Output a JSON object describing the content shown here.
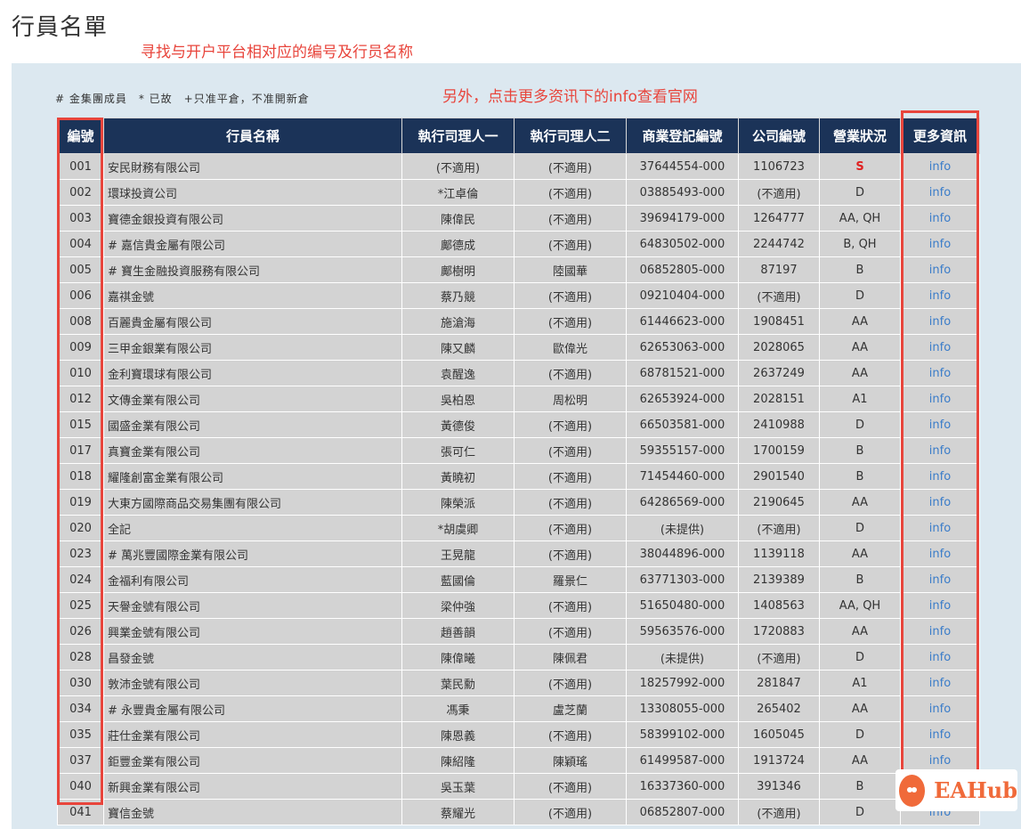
{
  "page": {
    "title": "行員名單",
    "annotation_top": "寻找与开户平台相对应的编号及行员名称",
    "annotation_mid": "另外，点击更多资讯下的info查看官网",
    "legend": "# 金集團成員　* 已故　+只准平倉，不准開新倉"
  },
  "table": {
    "headers": [
      "編號",
      "行員名稱",
      "執行司理人一",
      "執行司理人二",
      "商業登記編號",
      "公司編號",
      "營業狀況",
      "更多資訊"
    ],
    "rows": [
      {
        "id": "001",
        "name": "安民財務有限公司",
        "mgr1": "(不適用)",
        "mgr2": "(不適用)",
        "brn": "37644554-000",
        "co": "1106723",
        "status": "S",
        "info": "info"
      },
      {
        "id": "002",
        "name": "環球投資公司",
        "mgr1": "*江卓倫",
        "mgr2": "(不適用)",
        "brn": "03885493-000",
        "co": "(不適用)",
        "status": "D",
        "info": "info"
      },
      {
        "id": "003",
        "name": "寶德金銀投資有限公司",
        "mgr1": "陳偉民",
        "mgr2": "(不適用)",
        "brn": "39694179-000",
        "co": "1264777",
        "status": "AA, QH",
        "info": "info"
      },
      {
        "id": "004",
        "name": "# 嘉信貴金屬有限公司",
        "mgr1": "鄺德成",
        "mgr2": "(不適用)",
        "brn": "64830502-000",
        "co": "2244742",
        "status": "B, QH",
        "info": "info"
      },
      {
        "id": "005",
        "name": "# 寶生金融投資服務有限公司",
        "mgr1": "鄺樹明",
        "mgr2": "陸國華",
        "brn": "06852805-000",
        "co": "87197",
        "status": "B",
        "info": "info"
      },
      {
        "id": "006",
        "name": "嘉祺金號",
        "mgr1": "蔡乃競",
        "mgr2": "(不適用)",
        "brn": "09210404-000",
        "co": "(不適用)",
        "status": "D",
        "info": "info"
      },
      {
        "id": "008",
        "name": "百麗貴金屬有限公司",
        "mgr1": "施滄海",
        "mgr2": "(不適用)",
        "brn": "61446623-000",
        "co": "1908451",
        "status": "AA",
        "info": "info"
      },
      {
        "id": "009",
        "name": "三甲金銀業有限公司",
        "mgr1": "陳又麟",
        "mgr2": "歐偉光",
        "brn": "62653063-000",
        "co": "2028065",
        "status": "AA",
        "info": "info"
      },
      {
        "id": "010",
        "name": "金利寶環球有限公司",
        "mgr1": "袁醒逸",
        "mgr2": "(不適用)",
        "brn": "68781521-000",
        "co": "2637249",
        "status": "AA",
        "info": "info"
      },
      {
        "id": "012",
        "name": "文傳金業有限公司",
        "mgr1": "吳柏恩",
        "mgr2": "周松明",
        "brn": "62653924-000",
        "co": "2028151",
        "status": "A1",
        "info": "info"
      },
      {
        "id": "015",
        "name": "國盛金業有限公司",
        "mgr1": "黃德俊",
        "mgr2": "(不適用)",
        "brn": "66503581-000",
        "co": "2410988",
        "status": "D",
        "info": "info"
      },
      {
        "id": "017",
        "name": "真寶金業有限公司",
        "mgr1": "張可仁",
        "mgr2": "(不適用)",
        "brn": "59355157-000",
        "co": "1700159",
        "status": "B",
        "info": "info"
      },
      {
        "id": "018",
        "name": "耀隆創富金業有限公司",
        "mgr1": "黃曉初",
        "mgr2": "(不適用)",
        "brn": "71454460-000",
        "co": "2901540",
        "status": "B",
        "info": "info"
      },
      {
        "id": "019",
        "name": "大東方國際商品交易集團有限公司",
        "mgr1": "陳榮派",
        "mgr2": "(不適用)",
        "brn": "64286569-000",
        "co": "2190645",
        "status": "AA",
        "info": "info"
      },
      {
        "id": "020",
        "name": "全記",
        "mgr1": "*胡虞卿",
        "mgr2": "(不適用)",
        "brn": "(未提供)",
        "co": "(不適用)",
        "status": "D",
        "info": "info"
      },
      {
        "id": "023",
        "name": "# 萬兆豐國際金業有限公司",
        "mgr1": "王晃龍",
        "mgr2": "(不適用)",
        "brn": "38044896-000",
        "co": "1139118",
        "status": "AA",
        "info": "info"
      },
      {
        "id": "024",
        "name": "金福利有限公司",
        "mgr1": "藍國倫",
        "mgr2": "羅景仁",
        "brn": "63771303-000",
        "co": "2139389",
        "status": "B",
        "info": "info"
      },
      {
        "id": "025",
        "name": "天譽金號有限公司",
        "mgr1": "梁仲強",
        "mgr2": "(不適用)",
        "brn": "51650480-000",
        "co": "1408563",
        "status": "AA, QH",
        "info": "info"
      },
      {
        "id": "026",
        "name": "興業金號有限公司",
        "mgr1": "趙善韻",
        "mgr2": "(不適用)",
        "brn": "59563576-000",
        "co": "1720883",
        "status": "AA",
        "info": "info"
      },
      {
        "id": "028",
        "name": "昌發金號",
        "mgr1": "陳偉曦",
        "mgr2": "陳佩君",
        "brn": "(未提供)",
        "co": "(不適用)",
        "status": "D",
        "info": "info"
      },
      {
        "id": "030",
        "name": "敦沛金號有限公司",
        "mgr1": "葉民勳",
        "mgr2": "(不適用)",
        "brn": "18257992-000",
        "co": "281847",
        "status": "A1",
        "info": "info"
      },
      {
        "id": "034",
        "name": "# 永豐貴金屬有限公司",
        "mgr1": "馮秉",
        "mgr2": "盧芝蘭",
        "brn": "13308055-000",
        "co": "265402",
        "status": "AA",
        "info": "info"
      },
      {
        "id": "035",
        "name": "莊仕金業有限公司",
        "mgr1": "陳恩義",
        "mgr2": "(不適用)",
        "brn": "58399102-000",
        "co": "1605045",
        "status": "D",
        "info": "info"
      },
      {
        "id": "037",
        "name": "鉅豐金業有限公司",
        "mgr1": "陳紹隆",
        "mgr2": "陳穎瑤",
        "brn": "61499587-000",
        "co": "1913724",
        "status": "AA",
        "info": "info"
      },
      {
        "id": "040",
        "name": "新興金業有限公司",
        "mgr1": "吳玉葉",
        "mgr2": "(不適用)",
        "brn": "16337360-000",
        "co": "391346",
        "status": "B",
        "info": "info"
      },
      {
        "id": "041",
        "name": "寶信金號",
        "mgr1": "蔡耀光",
        "mgr2": "(不適用)",
        "brn": "06852807-000",
        "co": "(不適用)",
        "status": "D",
        "info": "info"
      }
    ]
  },
  "watermark": {
    "text": "EAHub"
  },
  "colors": {
    "header_bg": "#1b3358",
    "row_bg": "#d3d3d3",
    "panel_bg": "#dce8f0",
    "annotation": "#e8453c",
    "link": "#3a7cc9"
  }
}
